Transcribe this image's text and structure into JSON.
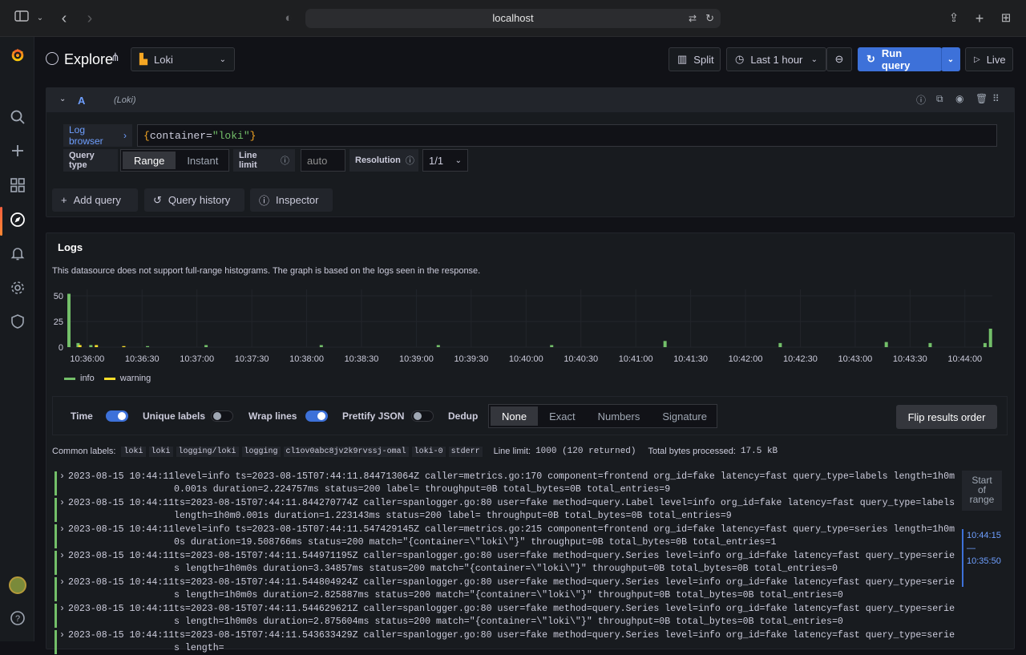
{
  "browser": {
    "url": "localhost"
  },
  "topbar": {
    "title": "Explore",
    "datasource": "Loki",
    "split_label": "Split",
    "time_range": "Last 1 hour",
    "run_query_label": "Run query",
    "live_label": "Live"
  },
  "query": {
    "ref_id": "A",
    "ds_hint": "(Loki)",
    "log_browser_label": "Log browser",
    "expr_prefix": "{container=",
    "expr_value": "\"loki\"",
    "expr_suffix": "}",
    "query_type_label": "Query type",
    "query_type_options": [
      "Range",
      "Instant"
    ],
    "query_type_selected": "Range",
    "line_limit_label": "Line limit",
    "line_limit_placeholder": "auto",
    "resolution_label": "Resolution",
    "resolution_value": "1/1"
  },
  "actions": {
    "add_query": "Add query",
    "query_history": "Query history",
    "inspector": "Inspector"
  },
  "logs": {
    "title": "Logs",
    "notice": "This datasource does not support full-range histograms. The graph is based on the logs seen in the response.",
    "legend": [
      "info",
      "warning"
    ],
    "options": {
      "time": "Time",
      "unique_labels": "Unique labels",
      "wrap_lines": "Wrap lines",
      "prettify_json": "Prettify JSON",
      "dedup": "Dedup",
      "dedup_options": [
        "None",
        "Exact",
        "Numbers",
        "Signature"
      ],
      "dedup_selected": "None",
      "flip_label": "Flip results order"
    },
    "common_labels_label": "Common labels:",
    "common_labels": [
      "loki",
      "loki",
      "logging/loki",
      "logging",
      "cl1ov0abc8jv2k9rvssj-omal",
      "loki-0",
      "stderr"
    ],
    "line_limit_text": "Line limit:",
    "line_limit_value": "1000 (120 returned)",
    "bytes_text": "Total bytes processed:",
    "bytes_value": "17.5 kB",
    "start_of_range": [
      "Start",
      "of",
      "range"
    ],
    "range_marker": [
      "10:44:15",
      "—",
      "10:35:50"
    ],
    "lines": [
      {
        "ts": "2023-08-15 10:44:11",
        "msg": "level=info ts=2023-08-15T07:44:11.844713064Z caller=metrics.go:170 component=frontend org_id=fake latency=fast query_type=labels length=1h0m0.001s duration=2.224757ms status=200 label= throughput=0B total_bytes=0B total_entries=9"
      },
      {
        "ts": "2023-08-15 10:44:11",
        "msg": "ts=2023-08-15T07:44:11.844270774Z caller=spanlogger.go:80 user=fake method=query.Label level=info org_id=fake latency=fast query_type=labels length=1h0m0.001s duration=1.223143ms status=200 label= throughput=0B total_bytes=0B total_entries=9"
      },
      {
        "ts": "2023-08-15 10:44:11",
        "msg": "level=info ts=2023-08-15T07:44:11.547429145Z caller=metrics.go:215 component=frontend org_id=fake latency=fast query_type=series length=1h0m0s duration=19.508766ms status=200 match=\"{container=\\\"loki\\\"}\" throughput=0B total_bytes=0B total_entries=1"
      },
      {
        "ts": "2023-08-15 10:44:11",
        "msg": "ts=2023-08-15T07:44:11.544971195Z caller=spanlogger.go:80 user=fake method=query.Series level=info org_id=fake latency=fast query_type=series length=1h0m0s duration=3.34857ms status=200 match=\"{container=\\\"loki\\\"}\" throughput=0B total_bytes=0B total_entries=0"
      },
      {
        "ts": "2023-08-15 10:44:11",
        "msg": "ts=2023-08-15T07:44:11.544804924Z caller=spanlogger.go:80 user=fake method=query.Series level=info org_id=fake latency=fast query_type=series length=1h0m0s duration=2.825887ms status=200 match=\"{container=\\\"loki\\\"}\" throughput=0B total_bytes=0B total_entries=0"
      },
      {
        "ts": "2023-08-15 10:44:11",
        "msg": "ts=2023-08-15T07:44:11.544629621Z caller=spanlogger.go:80 user=fake method=query.Series level=info org_id=fake latency=fast query_type=series length=1h0m0s duration=2.875604ms status=200 match=\"{container=\\\"loki\\\"}\" throughput=0B total_bytes=0B total_entries=0"
      },
      {
        "ts": "2023-08-15 10:44:11",
        "msg": "ts=2023-08-15T07:44:11.543633429Z caller=spanlogger.go:80 user=fake method=query.Series level=info org_id=fake latency=fast query_type=series length="
      }
    ]
  },
  "chart_data": {
    "type": "bar",
    "ylim": [
      0,
      50
    ],
    "yticks": [
      0,
      25,
      50
    ],
    "xticks": [
      "10:36:00",
      "10:36:30",
      "10:37:00",
      "10:37:30",
      "10:38:00",
      "10:38:30",
      "10:39:00",
      "10:39:30",
      "10:40:00",
      "10:40:30",
      "10:41:00",
      "10:41:30",
      "10:42:00",
      "10:42:30",
      "10:43:00",
      "10:43:30",
      "10:44:00"
    ],
    "x_start": "10:35:50",
    "x_end": "10:44:15",
    "series": [
      {
        "name": "info",
        "color": "#73bf69",
        "points": [
          [
            "10:35:50",
            52
          ],
          [
            "10:35:55",
            4
          ],
          [
            "10:36:02",
            2
          ],
          [
            "10:36:33",
            1
          ],
          [
            "10:37:05",
            2
          ],
          [
            "10:38:08",
            2
          ],
          [
            "10:39:12",
            2
          ],
          [
            "10:40:14",
            2
          ],
          [
            "10:41:16",
            6
          ],
          [
            "10:42:19",
            4
          ],
          [
            "10:43:17",
            5
          ],
          [
            "10:43:41",
            4
          ],
          [
            "10:44:11",
            4
          ],
          [
            "10:44:14",
            18
          ]
        ]
      },
      {
        "name": "warning",
        "color": "#fade2a",
        "points": [
          [
            "10:35:56",
            2
          ],
          [
            "10:36:05",
            2
          ],
          [
            "10:36:20",
            1
          ]
        ]
      }
    ]
  }
}
